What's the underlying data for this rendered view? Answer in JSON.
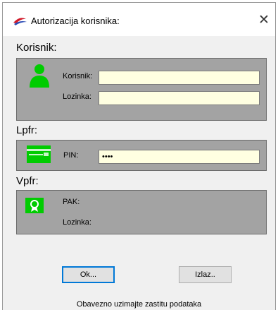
{
  "window": {
    "title": "Autorizacija korisnika:",
    "close_glyph": "✕"
  },
  "korisnik": {
    "heading": "Korisnik:",
    "icon": "user-icon",
    "username_label": "Korisnik:",
    "username_value": "",
    "password_label": "Lozinka:",
    "password_value": ""
  },
  "lpfr": {
    "heading": "Lpfr:",
    "icon": "card-icon",
    "pin_label": "PIN:",
    "pin_value": "****"
  },
  "vpfr": {
    "heading": "Vpfr:",
    "icon": "certificate-icon",
    "pak_label": "PAK:",
    "password_label": "Lozinka:"
  },
  "buttons": {
    "ok": "Ok...",
    "exit": "Izlaz.."
  },
  "footer": "Obavezno uzimajte zastitu podataka",
  "colors": {
    "panel": "#a3a3a3",
    "input_bg": "#ffffe1",
    "icon_green": "#00cc00"
  }
}
